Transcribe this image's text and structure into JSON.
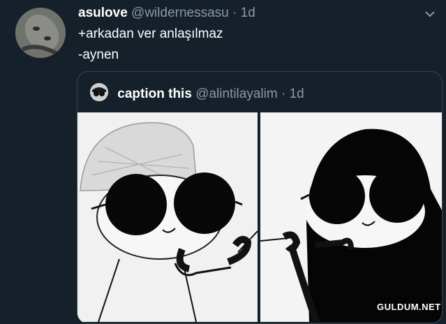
{
  "tweet": {
    "display_name": "asulove",
    "handle": "@wildernessasu",
    "separator": "·",
    "time": "1d",
    "lines": [
      "+arkadan ver anlaşılmaz",
      "-aynen"
    ]
  },
  "quoted_tweet": {
    "display_name": "caption this",
    "handle": "@alintilayalim",
    "separator": "·",
    "time": "1d"
  },
  "watermark": "GULDUM.NET",
  "icons": {
    "menu": "chevron-down-icon"
  },
  "colors": {
    "background": "#15202b",
    "secondary_text": "#8899a6",
    "border": "#38444d"
  }
}
